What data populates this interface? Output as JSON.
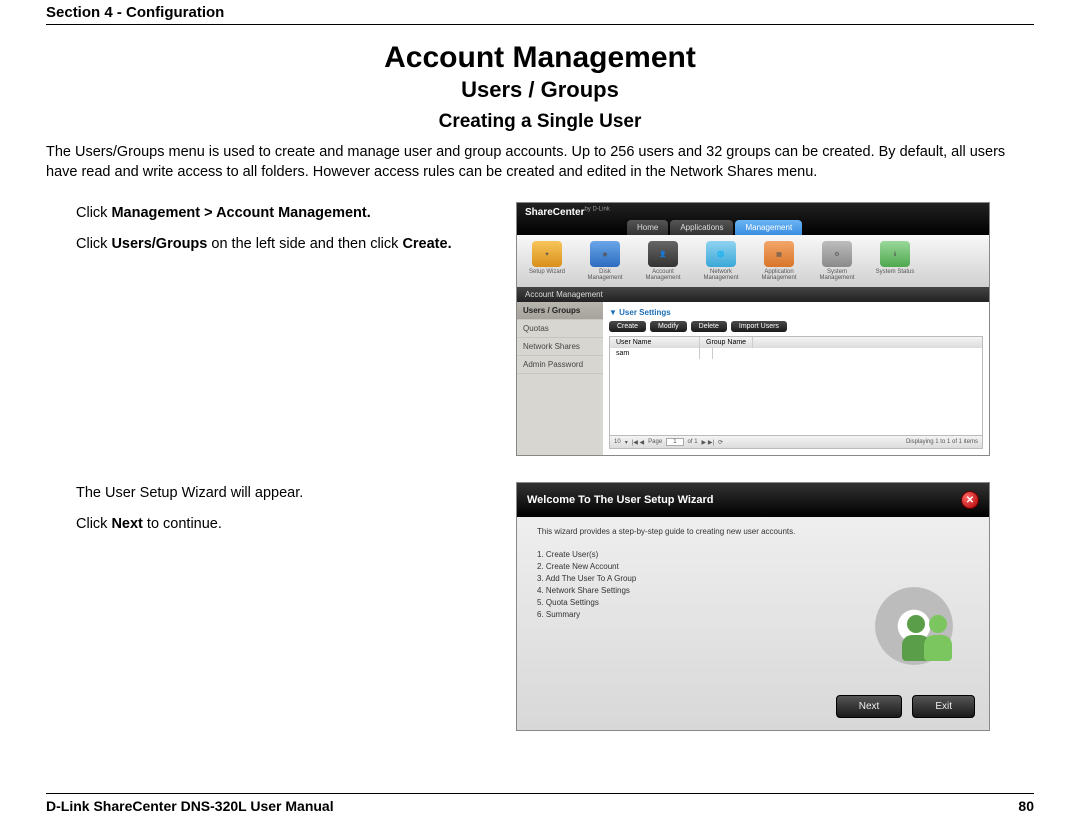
{
  "header": "Section 4 - Configuration",
  "h1": "Account Management",
  "h2": "Users / Groups",
  "h3": "Creating a Single User",
  "intro": "The Users/Groups menu is used to create and manage user and group accounts. Up to 256 users and 32 groups can be created. By default, all users have read and write access to all folders. However access rules can be created and edited in the Network Shares menu.",
  "step1": {
    "line1_a": "Click ",
    "line1_b": "Management > Account Management.",
    "line2_a": "Click ",
    "line2_b": "Users/Groups",
    "line2_c": " on the left side and then click ",
    "line2_d": "Create."
  },
  "shot1": {
    "logo": "ShareCenter",
    "logo_sub": "by D-Link",
    "tabs": {
      "home": "Home",
      "apps": "Applications",
      "mgmt": "Management"
    },
    "tools": {
      "t1": "Setup Wizard",
      "t2": "Disk Management",
      "t3": "Account Management",
      "t4": "Network Management",
      "t5": "Application Management",
      "t6": "System Management",
      "t7": "System Status"
    },
    "crumb": "Account Management",
    "side": {
      "s1": "Users / Groups",
      "s2": "Quotas",
      "s3": "Network Shares",
      "s4": "Admin Password"
    },
    "section": "User Settings",
    "btns": {
      "create": "Create",
      "modify": "Modify",
      "delete": "Delete",
      "import": "Import Users"
    },
    "th": {
      "c1": "User Name",
      "c2": "Group Name"
    },
    "row1": "sam",
    "pager": {
      "a": "10",
      "b": "Page",
      "c": "1",
      "d": "of 1",
      "e": "Displaying 1 to 1 of 1 items"
    }
  },
  "step2": {
    "line1": "The User Setup Wizard will appear.",
    "line2_a": "Click ",
    "line2_b": "Next",
    "line2_c": " to continue."
  },
  "shot2": {
    "title": "Welcome To The User Setup Wizard",
    "desc": "This wizard provides a step-by-step guide to creating new user accounts.",
    "steps": {
      "s1": "1. Create User(s)",
      "s2": "2. Create New Account",
      "s3": "3. Add The User To A Group",
      "s4": "4. Network Share Settings",
      "s5": "5. Quota Settings",
      "s6": "6. Summary"
    },
    "next": "Next",
    "exit": "Exit"
  },
  "footer": {
    "left": "D-Link ShareCenter DNS-320L User Manual",
    "right": "80"
  }
}
